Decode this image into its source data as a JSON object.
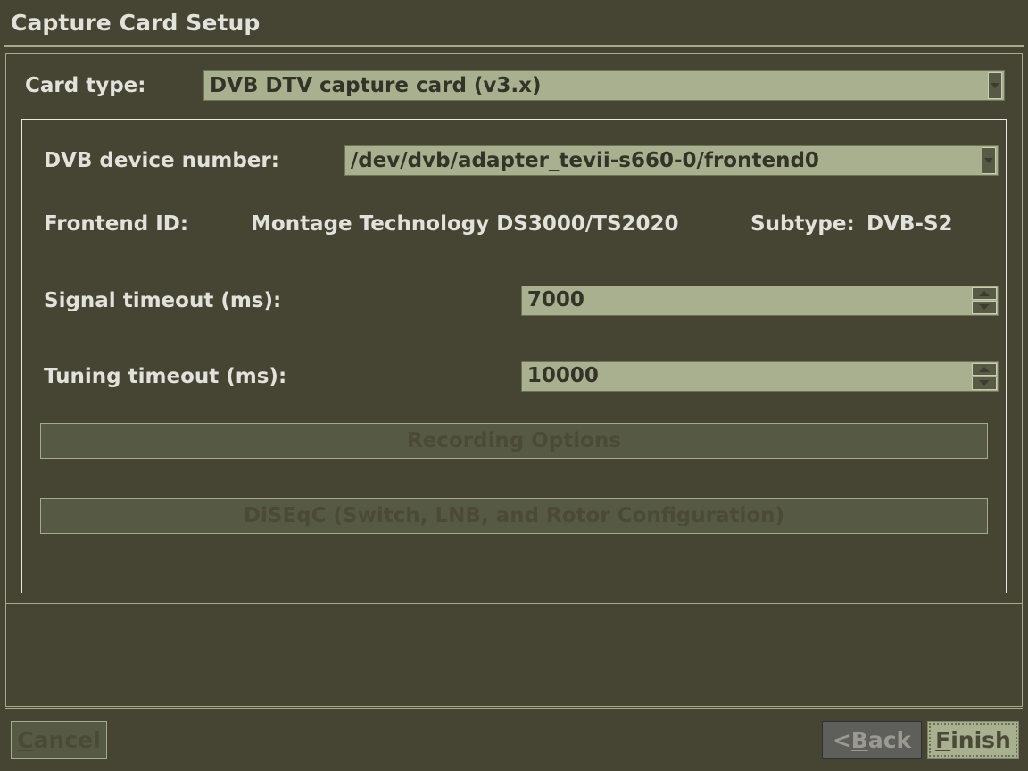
{
  "window": {
    "title": "Capture Card Setup"
  },
  "card_type": {
    "label": "Card type:",
    "value": "DVB DTV capture card (v3.x)",
    "arrow_icon": "chevron-down-icon"
  },
  "dvb_group": {
    "device_number": {
      "label": "DVB device number:",
      "value": "/dev/dvb/adapter_tevii-s660-0/frontend0",
      "arrow_icon": "chevron-down-icon"
    },
    "frontend": {
      "id_label": "Frontend ID:",
      "id_value": "Montage Technology DS3000/TS2020",
      "subtype_label": "Subtype:",
      "subtype_value": "DVB-S2"
    },
    "signal_timeout": {
      "label": "Signal timeout (ms):",
      "value": "7000",
      "up_icon": "triangle-up-icon",
      "down_icon": "triangle-down-icon"
    },
    "tuning_timeout": {
      "label": "Tuning timeout (ms):",
      "value": "10000",
      "up_icon": "triangle-up-icon",
      "down_icon": "triangle-down-icon"
    },
    "recording_options_button": "Recording Options",
    "diseqc_button": "DiSEqC (Switch, LNB, and Rotor Configuration)"
  },
  "footer": {
    "cancel": {
      "mnemonic": "C",
      "rest": "ancel"
    },
    "back": {
      "prefix": "< ",
      "mnemonic": "B",
      "rest": "ack"
    },
    "finish": {
      "mnemonic": "F",
      "rest": "inish"
    }
  },
  "colors": {
    "background": "#464433",
    "frame_line": "#a3ab8b",
    "groupbox_line": "#e8e8e0",
    "field_background": "#a8b08f",
    "field_text": "#333328",
    "text": "#e2e2dc",
    "disabled_text": "#4b4a38"
  }
}
